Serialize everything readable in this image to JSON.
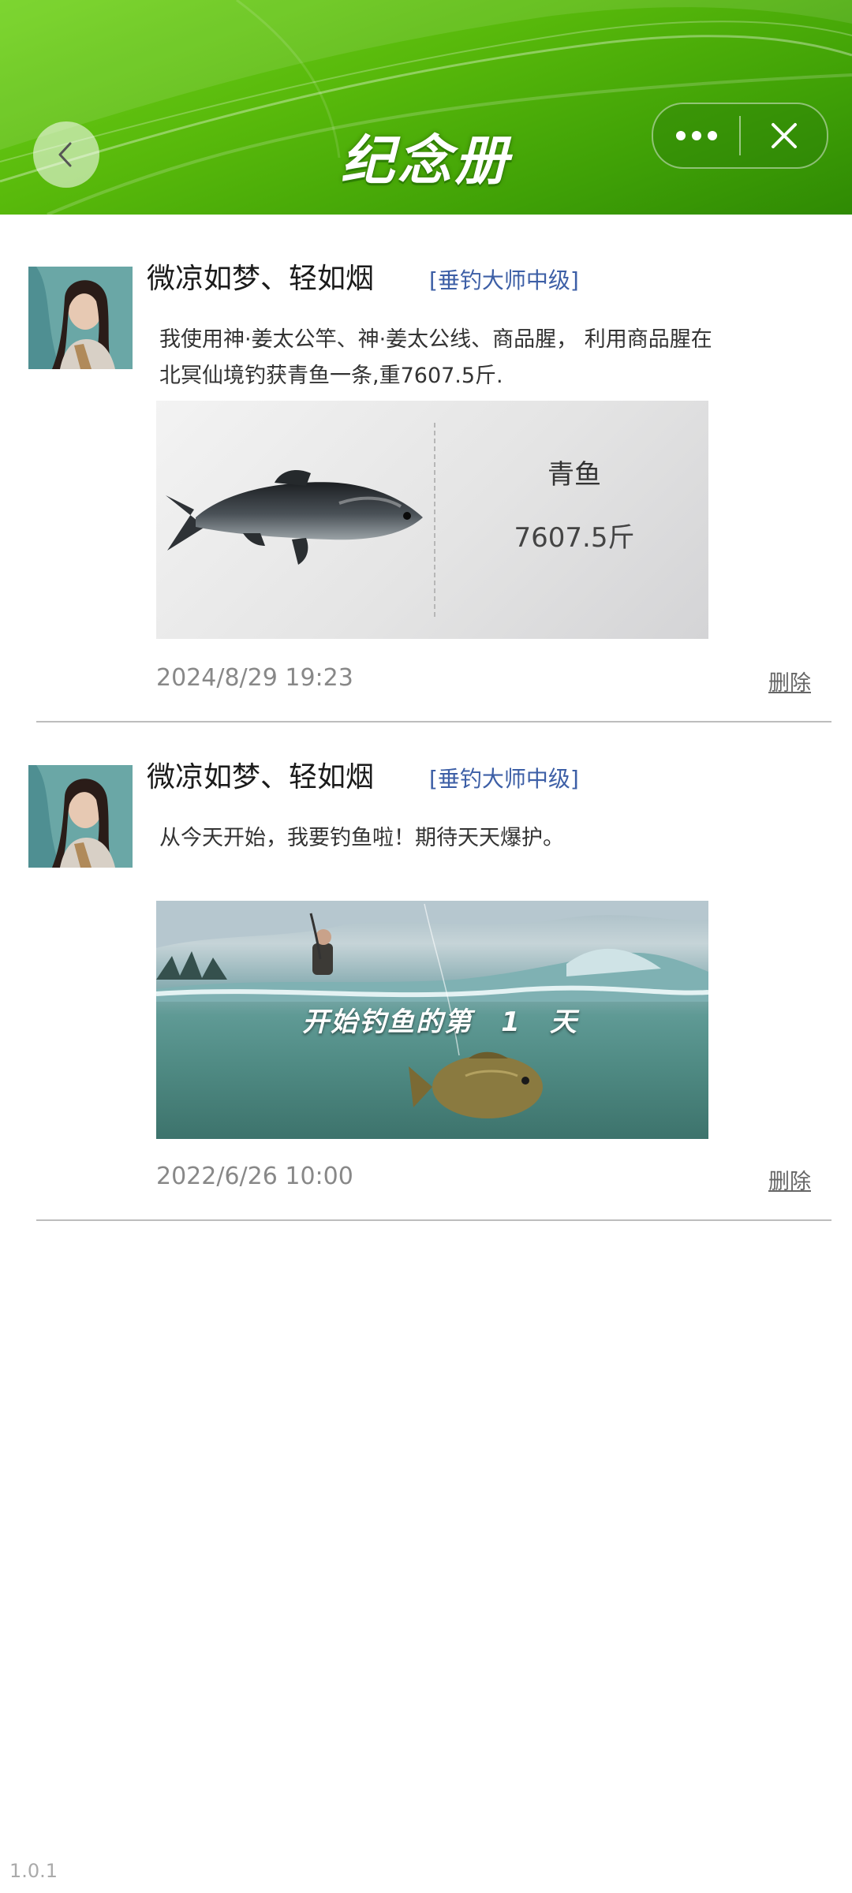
{
  "header": {
    "title": "纪念册",
    "back_icon": "back-arrow-icon",
    "more_icon": "more-dots-icon",
    "close_icon": "close-icon",
    "accent_color": "#5cb80c"
  },
  "posts": [
    {
      "username": "微凉如梦、轻如烟",
      "rank": "[垂钓大师中级]",
      "content": "我使用神·姜太公竿、神·姜太公线、商品腥， 利用商品腥在北冥仙境钓获青鱼一条,重7607.5斤.",
      "catch": {
        "fish_name": "青鱼",
        "weight": "7607.5斤"
      },
      "timestamp": "2024/8/29  19:23",
      "delete_label": "删除"
    },
    {
      "username": "微凉如梦、轻如烟",
      "rank": "[垂钓大师中级]",
      "content": "从今天开始，我要钓鱼啦！期待天天爆护。",
      "banner_text": "开始钓鱼的第　1　天",
      "timestamp": "2022/6/26  10:00",
      "delete_label": "删除"
    }
  ],
  "footer": {
    "version": "1.0.1"
  }
}
